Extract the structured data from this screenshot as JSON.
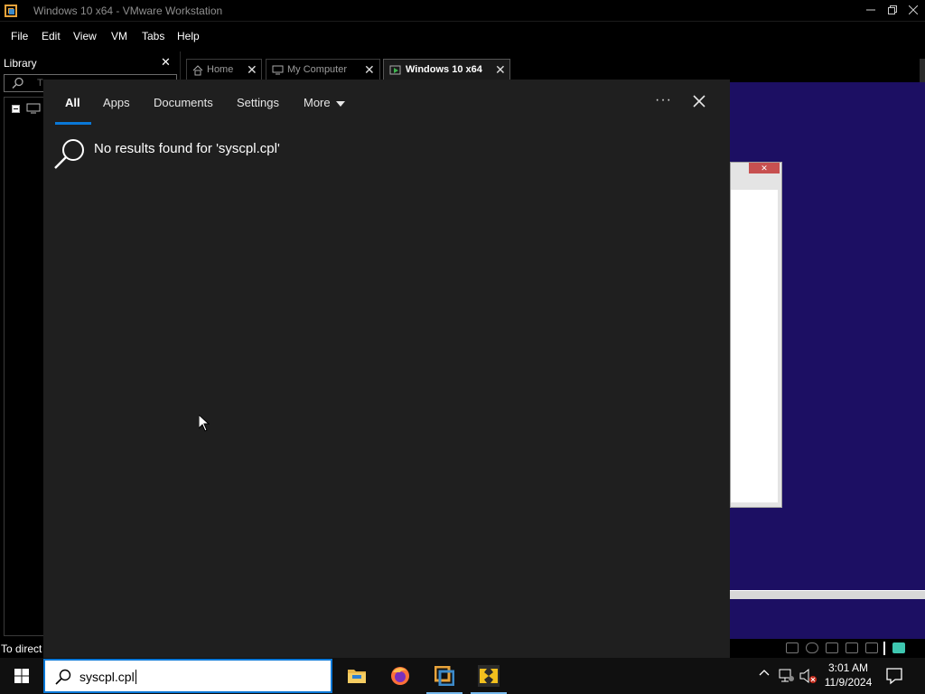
{
  "window": {
    "title": "Windows 10 x64 - VMware Workstation",
    "minimize_icon": "minimize-icon",
    "maximize_icon": "restore-icon",
    "close_icon": "close-icon"
  },
  "menu": [
    "File",
    "Edit",
    "View",
    "VM",
    "Tabs",
    "Help"
  ],
  "library": {
    "title": "Library",
    "close": "✕",
    "search_placeholder": "T"
  },
  "tabs": [
    {
      "label": "Home",
      "icon": "home-icon",
      "active": false
    },
    {
      "label": "My Computer",
      "icon": "computer-icon",
      "active": false
    },
    {
      "label": "Windows 10 x64",
      "icon": "vm-running-icon",
      "active": true
    }
  ],
  "search_flyout": {
    "tabs": [
      "All",
      "Apps",
      "Documents",
      "Settings",
      "More"
    ],
    "active_tab": "All",
    "more_label": "More",
    "no_results": "No results found for 'syscpl.cpl'",
    "options_icon": "···",
    "accent": "#0a78d7"
  },
  "vm_dialog": {
    "close_glyph": "✕"
  },
  "statusbar": {
    "text": "To direct"
  },
  "taskbar": {
    "search_value": "syscpl.cpl",
    "apps": [
      "file-explorer-icon",
      "firefox-icon",
      "vmware-workstation-icon",
      "vmware-app-icon"
    ],
    "tray_chevron": "^",
    "time": "3:01 AM",
    "date": "11/9/2024"
  },
  "colors": {
    "vm_background": "#1c0f63",
    "flyout_background": "#1f1f1f",
    "taskbar": "#101010"
  }
}
